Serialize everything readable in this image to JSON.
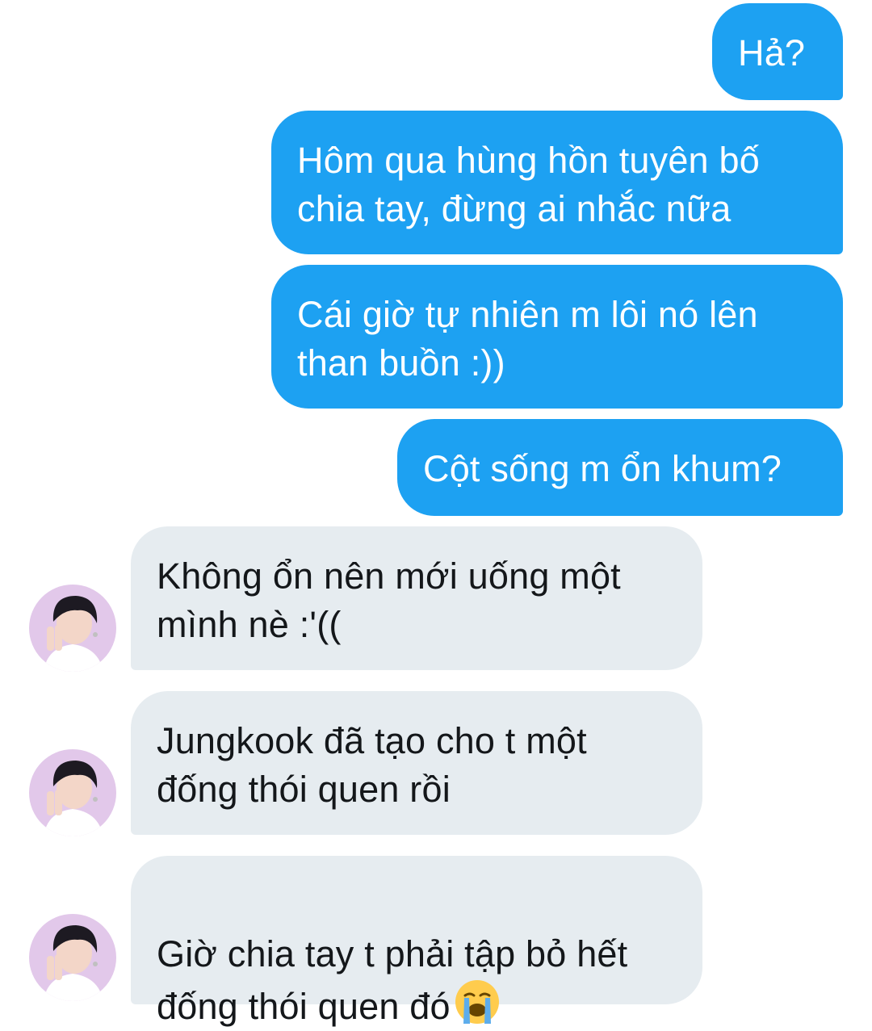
{
  "messages": {
    "sent": [
      {
        "text": "Hả?"
      },
      {
        "text": "Hôm qua hùng hồn tuyên bố\nchia tay, đừng ai nhắc nữa"
      },
      {
        "text": "Cái giờ tự nhiên m lôi nó lên\nthan buồn :))"
      },
      {
        "text": "Cột sống m ổn khum?"
      }
    ],
    "received": [
      {
        "text": "Không ổn nên mới uống một\nmình nè :'(("
      },
      {
        "text": "Jungkook đã tạo cho t một\nđống thói quen rồi"
      },
      {
        "text": "Giờ chia tay t phải tập bỏ hết\nđống thói quen đó",
        "emoji": "loudly-crying-face-icon"
      }
    ]
  },
  "colors": {
    "sent_bubble": "#1da1f2",
    "received_bubble": "#e6ecf0",
    "sent_text": "#ffffff",
    "received_text": "#14171a",
    "avatar_background": "#e2c8ea"
  }
}
